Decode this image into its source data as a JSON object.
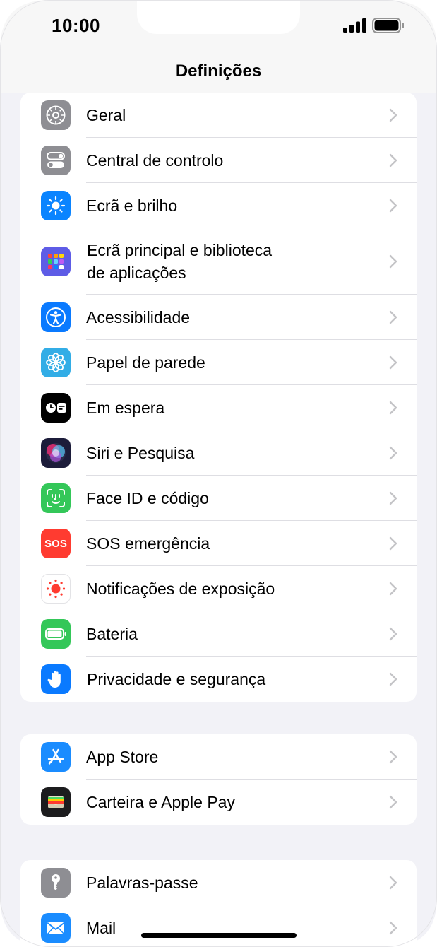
{
  "status_bar": {
    "time": "10:00"
  },
  "nav": {
    "title": "Definições"
  },
  "groups": [
    {
      "items": [
        {
          "label": "Geral",
          "icon": "gear-icon",
          "color": "#8e8e93"
        },
        {
          "label": "Central de controlo",
          "icon": "toggles-icon",
          "color": "#8e8e93"
        },
        {
          "label": "Ecrã e brilho",
          "icon": "sun-icon",
          "color": "#0a84ff"
        },
        {
          "label_line1": "Ecrã principal e biblioteca",
          "label_line2": "de aplicações",
          "icon": "app-grid-icon",
          "color": "#5e5ce6"
        },
        {
          "label": "Acessibilidade",
          "icon": "accessibility-icon",
          "color": "#0a7aff"
        },
        {
          "label": "Papel de parede",
          "icon": "flower-icon",
          "color": "#32ade6"
        },
        {
          "label": "Em espera",
          "icon": "standby-icon",
          "color": "#000000"
        },
        {
          "label": "Siri e Pesquisa",
          "icon": "siri-icon",
          "color": "#1c1c3a"
        },
        {
          "label": "Face ID e código",
          "icon": "faceid-icon",
          "color": "#34c759"
        },
        {
          "label": "SOS emergência",
          "icon": "sos-icon",
          "color": "#ff3b30",
          "icon_text": "SOS"
        },
        {
          "label": "Notificações de exposição",
          "icon": "exposure-icon",
          "color": "#ffffff"
        },
        {
          "label": "Bateria",
          "icon": "battery-icon",
          "color": "#34c759"
        },
        {
          "label": "Privacidade e segurança",
          "icon": "hand-icon",
          "color": "#0a7aff"
        }
      ]
    },
    {
      "items": [
        {
          "label": "App Store",
          "icon": "app-store-icon",
          "color": "#1a8cff"
        },
        {
          "label": "Carteira e Apple Pay",
          "icon": "wallet-icon",
          "color": "#1c1c1e"
        }
      ]
    },
    {
      "items": [
        {
          "label": "Palavras-passe",
          "icon": "key-icon",
          "color": "#8e8e93"
        },
        {
          "label": "Mail",
          "icon": "mail-icon",
          "color": "#1a8cff"
        }
      ]
    }
  ]
}
